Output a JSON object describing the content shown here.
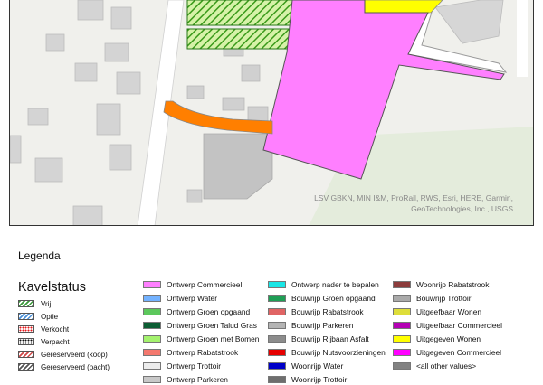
{
  "attribution": "LSV GBKN, MIN I&M, ProRail, RWS, Esri, HERE, Garmin, GeoTechnologies, Inc., USGS",
  "legend_title": "Legenda",
  "kavelstatus": {
    "heading": "Kavelstatus",
    "items": [
      {
        "label": "Vrij",
        "pattern": "hatch",
        "color": "#3a9a3a"
      },
      {
        "label": "Optie",
        "pattern": "hatch",
        "color": "#4a90d8"
      },
      {
        "label": "Verkocht",
        "pattern": "dots",
        "color": "#e41a1c"
      },
      {
        "label": "Verpacht",
        "pattern": "dots",
        "color": "#111111"
      },
      {
        "label": "Gereserveerd (koop)",
        "pattern": "hatch",
        "color": "#d04a4a"
      },
      {
        "label": "Gereserveerd (pacht)",
        "pattern": "hatch",
        "color": "#555555"
      }
    ]
  },
  "legend_columns": [
    [
      {
        "label": "Ontwerp Commercieel",
        "color": "#ff7fff"
      },
      {
        "label": "Ontwerp Water",
        "color": "#73b2ff"
      },
      {
        "label": "Ontwerp Groen opgaand",
        "color": "#5cc85c"
      },
      {
        "label": "Ontwerp Groen Talud Gras",
        "color": "#0b5d33"
      },
      {
        "label": "Ontwerp Groen met Bomen",
        "color": "#a4f26e"
      },
      {
        "label": "Ontwerp Rabatstrook",
        "color": "#f4786e"
      },
      {
        "label": "Ontwerp Trottoir",
        "color": "#ececec"
      },
      {
        "label": "Ontwerp Parkeren",
        "color": "#c8c8c8"
      }
    ],
    [
      {
        "label": "Ontwerp nader te bepalen",
        "color": "#19e6e6"
      },
      {
        "label": "Bouwrijp Groen opgaand",
        "color": "#1f9e55"
      },
      {
        "label": "Bouwrijp Rabatstrook",
        "color": "#e06464"
      },
      {
        "label": "Bouwrijp Parkeren",
        "color": "#b4b4b4"
      },
      {
        "label": "Bouwrijp Rijbaan Asfalt",
        "color": "#8c8c8c"
      },
      {
        "label": "Bouwrijp Nutsvoorzieningen",
        "color": "#e60000"
      },
      {
        "label": "Woonrijp Water",
        "color": "#0000c8"
      },
      {
        "label": "Woonrijp Trottoir",
        "color": "#6e6e6e"
      }
    ],
    [
      {
        "label": "Woonrijp Rabatstrook",
        "color": "#8c3c3c"
      },
      {
        "label": "Bouwrijp Trottoir",
        "color": "#aaaaaa"
      },
      {
        "label": "Uitgeefbaar Wonen",
        "color": "#dede3a"
      },
      {
        "label": "Uitgeefbaar Commercieel",
        "color": "#b400b4"
      },
      {
        "label": "Uitgegeven Wonen",
        "color": "#ffff00"
      },
      {
        "label": "Uitgegeven Commercieel",
        "color": "#ff00ff"
      },
      {
        "label": "<all other values>",
        "color": "#828282"
      }
    ]
  ]
}
